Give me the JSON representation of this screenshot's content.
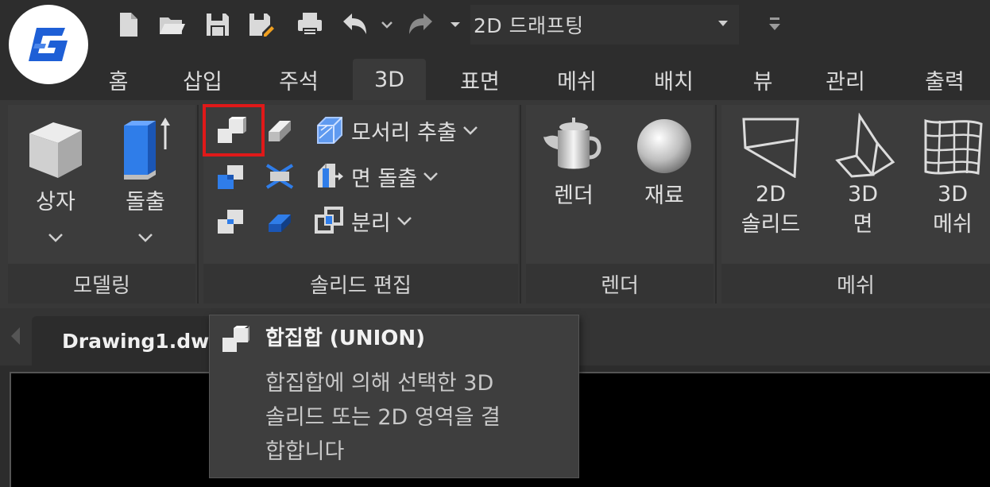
{
  "quick_access": {
    "workspace": "2D 드래프팅",
    "icons": [
      "new-file-icon",
      "open-folder-icon",
      "save-icon",
      "save-as-icon",
      "print-icon",
      "undo-icon",
      "redo-icon"
    ]
  },
  "tabs": [
    {
      "label": "홈"
    },
    {
      "label": "삽입"
    },
    {
      "label": "주석"
    },
    {
      "label": "3D",
      "active": true
    },
    {
      "label": "표면"
    },
    {
      "label": "메쉬"
    },
    {
      "label": "배치"
    },
    {
      "label": "뷰"
    },
    {
      "label": "관리"
    },
    {
      "label": "출력"
    }
  ],
  "panels": {
    "modeling": {
      "title": "모델링",
      "buttons": [
        "상자",
        "돌출"
      ]
    },
    "solid_edit": {
      "title": "솔리드 편집",
      "rows": [
        "모서리 추출",
        "면 돌출",
        "분리"
      ]
    },
    "render": {
      "title": "렌더",
      "buttons": [
        "렌더",
        "재료"
      ]
    },
    "mesh": {
      "title": "메쉬",
      "buttons": [
        {
          "line1": "2D",
          "line2": "솔리드"
        },
        {
          "line1": "3D",
          "line2": "면"
        },
        {
          "line1": "3D",
          "line2": "메쉬"
        }
      ]
    }
  },
  "document": {
    "tab_label": "Drawing1.dw"
  },
  "tooltip": {
    "title": "합집합 (UNION)",
    "lines": [
      "합집합에 의해 선택한 3D",
      "솔리드 또는 2D 영역을 결",
      "합합니다"
    ]
  },
  "colors": {
    "background": "#2b2b2b",
    "ribbon": "#383838",
    "highlight": "#e01919",
    "logo_blue": "#1e5fd6"
  }
}
